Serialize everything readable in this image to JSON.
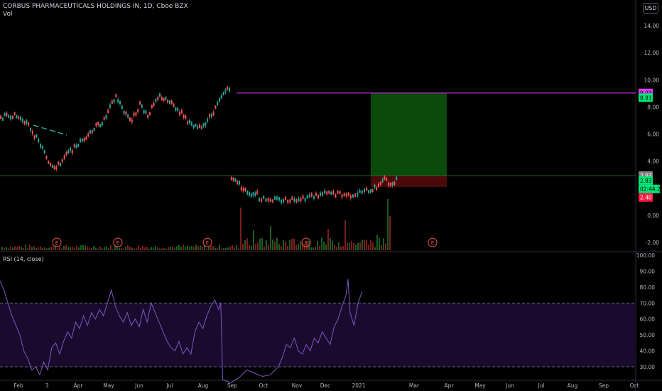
{
  "header": {
    "symbol_title": "CORBUS PHARMACEUTICALS HOLDINGS IN, 1D, Cboe BZX",
    "volume_label": "Vol"
  },
  "currency_button": "USD",
  "rsi_label": "RSI (14, close)",
  "colors": {
    "up": "#26a69a",
    "down": "#ef5350",
    "target_line": "#9c27b0",
    "profit_zone": "#0a4a0a",
    "loss_zone": "#4a0a0a",
    "rsi_line": "#7e57c2",
    "rsi_band": "#1a0a2e",
    "earnings": "#ef5350"
  },
  "price_axis": {
    "ticks": [
      "14.00",
      "12.00",
      "10.00",
      "8.00",
      "6.00",
      "4.00",
      "2.00",
      "0.00",
      "-2.00"
    ],
    "tick_values": [
      14,
      12,
      10,
      8,
      6,
      4,
      2,
      0,
      -2
    ],
    "labels": [
      {
        "text": "9.03",
        "value": 9.03,
        "bg": "#e040fb",
        "fg": "#000"
      },
      {
        "text": "8.91",
        "value": 8.68,
        "bg": "#00e676",
        "fg": "#000"
      },
      {
        "text": "2.93",
        "value": 2.93,
        "bg": "#808080",
        "fg": "#fff"
      },
      {
        "text": "2.83",
        "value": 2.57,
        "bg": "#00e676",
        "fg": "#000"
      },
      {
        "text": "02:44:25",
        "value": 1.95,
        "bg": "#00e676",
        "fg": "#000"
      },
      {
        "text": "2.40",
        "value": 1.32,
        "bg": "#ff1744",
        "fg": "#fff"
      }
    ]
  },
  "rsi_axis": {
    "ticks": [
      "100.00",
      "90.00",
      "80.00",
      "70.00",
      "60.00",
      "50.00",
      "40.00",
      "30.00"
    ],
    "tick_values": [
      100,
      90,
      80,
      70,
      60,
      50,
      40,
      30
    ],
    "overbought": 70,
    "oversold": 30
  },
  "time_axis": [
    "Feb",
    "3",
    "Apr",
    "May",
    "Jun",
    "Jul",
    "Aug",
    "Sep",
    "Oct",
    "Nov",
    "Dec",
    "2021",
    "Mar",
    "Apr",
    "May",
    "Jun",
    "Jul",
    "Aug",
    "Sep",
    "Oct"
  ],
  "earnings_marker": "E",
  "chart_data": {
    "type": "candlestick",
    "title": "CORBUS PHARMACEUTICALS HOLDINGS IN, 1D, Cboe BZX",
    "ylim": [
      -2.6,
      15
    ],
    "price_segments": [
      {
        "x": [
          0,
          0.03,
          0.06,
          0.08,
          0.1,
          0.12
        ],
        "y": [
          7.2,
          7.4,
          7.0,
          6.2,
          5.2,
          4.0
        ]
      },
      {
        "x": [
          0.12,
          0.14,
          0.17,
          0.2,
          0.23,
          0.26
        ],
        "y": [
          4.0,
          3.5,
          4.6,
          5.4,
          6.3,
          7.0
        ]
      },
      {
        "x": [
          0.26,
          0.29,
          0.31,
          0.33,
          0.35,
          0.37
        ],
        "y": [
          7.0,
          8.8,
          7.7,
          7.0,
          8.2,
          7.4
        ]
      },
      {
        "x": [
          0.37,
          0.4,
          0.43,
          0.46,
          0.48,
          0.5,
          0.53
        ],
        "y": [
          7.4,
          8.8,
          8.2,
          7.4,
          6.6,
          6.4,
          7.4
        ]
      },
      {
        "x": [
          0.53,
          0.55,
          0.57,
          0.58
        ],
        "y": [
          7.4,
          8.4,
          9.4,
          9.5
        ]
      },
      {
        "x": [
          0.58,
          0.59,
          0.61,
          0.63,
          0.65
        ],
        "y": [
          2.6,
          2.7,
          1.9,
          1.6,
          1.7
        ]
      },
      {
        "x": [
          0.65,
          0.7,
          0.76,
          0.82,
          0.88,
          0.92,
          0.95
        ],
        "y": [
          1.3,
          1.1,
          1.3,
          1.6,
          1.5,
          1.8,
          2.1
        ]
      },
      {
        "x": [
          0.95,
          0.97,
          0.98,
          1.0
        ],
        "y": [
          2.3,
          2.7,
          2.2,
          2.9
        ]
      }
    ],
    "position": {
      "entry": 2.93,
      "target": 9.03,
      "stop": 2.4
    },
    "rsi_series": [
      {
        "x": 0.0,
        "y": 84
      },
      {
        "x": 0.01,
        "y": 78
      },
      {
        "x": 0.02,
        "y": 70
      },
      {
        "x": 0.03,
        "y": 62
      },
      {
        "x": 0.04,
        "y": 56
      },
      {
        "x": 0.05,
        "y": 50
      },
      {
        "x": 0.06,
        "y": 40
      },
      {
        "x": 0.07,
        "y": 35
      },
      {
        "x": 0.08,
        "y": 28
      },
      {
        "x": 0.09,
        "y": 30
      },
      {
        "x": 0.1,
        "y": 25
      },
      {
        "x": 0.11,
        "y": 33
      },
      {
        "x": 0.12,
        "y": 28
      },
      {
        "x": 0.13,
        "y": 42
      },
      {
        "x": 0.14,
        "y": 45
      },
      {
        "x": 0.15,
        "y": 38
      },
      {
        "x": 0.16,
        "y": 46
      },
      {
        "x": 0.17,
        "y": 52
      },
      {
        "x": 0.18,
        "y": 48
      },
      {
        "x": 0.19,
        "y": 58
      },
      {
        "x": 0.2,
        "y": 54
      },
      {
        "x": 0.21,
        "y": 62
      },
      {
        "x": 0.22,
        "y": 56
      },
      {
        "x": 0.23,
        "y": 64
      },
      {
        "x": 0.24,
        "y": 60
      },
      {
        "x": 0.25,
        "y": 66
      },
      {
        "x": 0.26,
        "y": 62
      },
      {
        "x": 0.27,
        "y": 70
      },
      {
        "x": 0.28,
        "y": 78
      },
      {
        "x": 0.29,
        "y": 68
      },
      {
        "x": 0.3,
        "y": 62
      },
      {
        "x": 0.31,
        "y": 58
      },
      {
        "x": 0.32,
        "y": 64
      },
      {
        "x": 0.33,
        "y": 56
      },
      {
        "x": 0.34,
        "y": 60
      },
      {
        "x": 0.35,
        "y": 55
      },
      {
        "x": 0.36,
        "y": 66
      },
      {
        "x": 0.37,
        "y": 58
      },
      {
        "x": 0.38,
        "y": 70
      },
      {
        "x": 0.39,
        "y": 64
      },
      {
        "x": 0.4,
        "y": 58
      },
      {
        "x": 0.41,
        "y": 52
      },
      {
        "x": 0.42,
        "y": 46
      },
      {
        "x": 0.43,
        "y": 42
      },
      {
        "x": 0.44,
        "y": 40
      },
      {
        "x": 0.45,
        "y": 46
      },
      {
        "x": 0.46,
        "y": 38
      },
      {
        "x": 0.47,
        "y": 42
      },
      {
        "x": 0.48,
        "y": 38
      },
      {
        "x": 0.49,
        "y": 52
      },
      {
        "x": 0.5,
        "y": 58
      },
      {
        "x": 0.51,
        "y": 54
      },
      {
        "x": 0.52,
        "y": 62
      },
      {
        "x": 0.53,
        "y": 68
      },
      {
        "x": 0.54,
        "y": 72
      },
      {
        "x": 0.55,
        "y": 66
      },
      {
        "x": 0.555,
        "y": 70
      },
      {
        "x": 0.56,
        "y": 22
      },
      {
        "x": 0.58,
        "y": 20
      },
      {
        "x": 0.6,
        "y": 23
      },
      {
        "x": 0.62,
        "y": 28
      },
      {
        "x": 0.64,
        "y": 26
      },
      {
        "x": 0.66,
        "y": 24
      },
      {
        "x": 0.68,
        "y": 25
      },
      {
        "x": 0.7,
        "y": 30
      },
      {
        "x": 0.71,
        "y": 36
      },
      {
        "x": 0.72,
        "y": 44
      },
      {
        "x": 0.73,
        "y": 42
      },
      {
        "x": 0.74,
        "y": 48
      },
      {
        "x": 0.75,
        "y": 40
      },
      {
        "x": 0.76,
        "y": 38
      },
      {
        "x": 0.77,
        "y": 44
      },
      {
        "x": 0.78,
        "y": 40
      },
      {
        "x": 0.79,
        "y": 48
      },
      {
        "x": 0.8,
        "y": 45
      },
      {
        "x": 0.81,
        "y": 52
      },
      {
        "x": 0.82,
        "y": 48
      },
      {
        "x": 0.83,
        "y": 44
      },
      {
        "x": 0.84,
        "y": 55
      },
      {
        "x": 0.85,
        "y": 60
      },
      {
        "x": 0.86,
        "y": 68
      },
      {
        "x": 0.87,
        "y": 75
      },
      {
        "x": 0.875,
        "y": 85
      },
      {
        "x": 0.88,
        "y": 64
      },
      {
        "x": 0.89,
        "y": 56
      },
      {
        "x": 0.9,
        "y": 70
      },
      {
        "x": 0.91,
        "y": 77
      }
    ]
  }
}
